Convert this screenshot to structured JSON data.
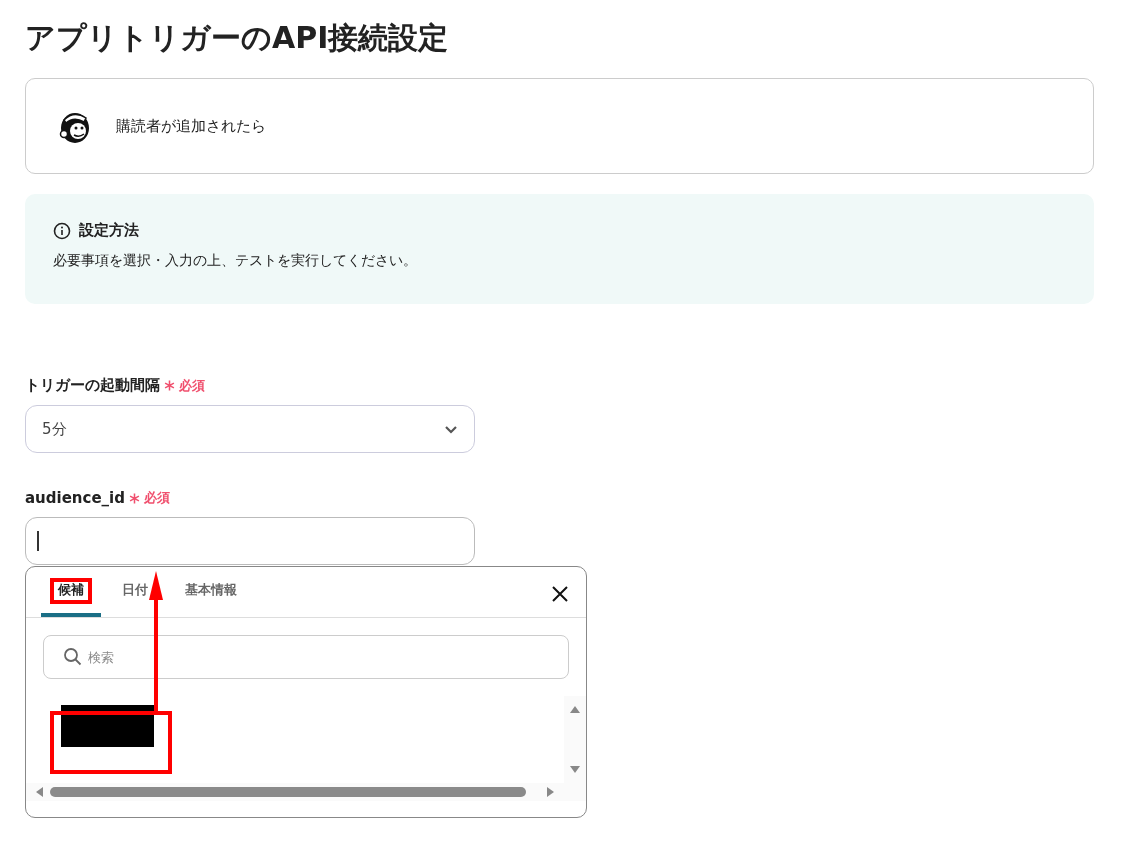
{
  "page_title": "アプリトリガーのAPI接続設定",
  "trigger_card": {
    "label": "購読者が追加されたら"
  },
  "info_box": {
    "title": "設定方法",
    "text": "必要事項を選択・入力の上、テストを実行してください。"
  },
  "fields": [
    {
      "kind": "select",
      "label": "トリガーの起動間隔",
      "required": "必須",
      "value": "5分"
    },
    {
      "kind": "text",
      "label": "audience_id",
      "required": "必須",
      "focused": true
    }
  ],
  "popup": {
    "tabs": [
      {
        "label": "候補",
        "selected": true
      },
      {
        "label": "日付",
        "selected": false
      },
      {
        "label": "基本情報",
        "selected": false
      }
    ],
    "search": {
      "placeholder": "検索"
    },
    "candidates": [
      {
        "redacted": true
      }
    ]
  }
}
